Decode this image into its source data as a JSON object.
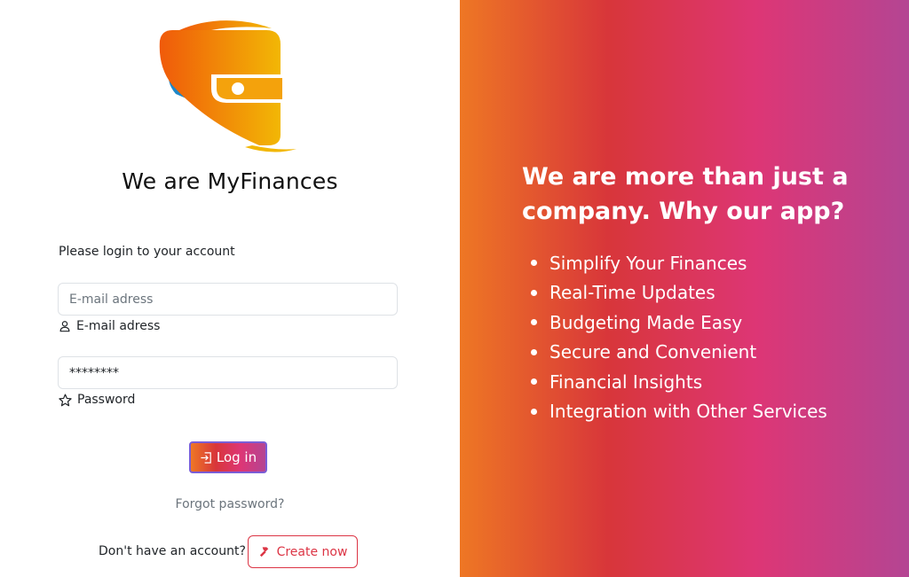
{
  "left": {
    "logo": {
      "icon": "wallet-logo-icon",
      "colors": {
        "orange": "#f05a0a",
        "yellow": "#f2b705",
        "blue": "#1e88c8"
      }
    },
    "title": "We are MyFinances",
    "prompt": "Please login to your account",
    "email": {
      "placeholder": "E-mail adress",
      "label": "E-mail adress",
      "icon": "person-icon"
    },
    "password": {
      "value": "********",
      "label": "Password",
      "icon": "star-icon"
    },
    "login_button": {
      "label": "Log in",
      "icon": "login-icon"
    },
    "forgot_link": "Forgot password?",
    "signup": {
      "prompt": "Don't have an account?",
      "button_label": "Create now",
      "icon": "hammer-icon"
    }
  },
  "right": {
    "headline": "We are more than just a company. Why our app?",
    "features": [
      "Simplify Your Finances",
      "Real-Time Updates",
      "Budgeting Made Easy",
      "Secure and Convenient",
      "Financial Insights",
      "Integration with Other Services"
    ]
  },
  "colors": {
    "gradient": [
      "#ee7724",
      "#d8363a",
      "#dd3675",
      "#b44593"
    ],
    "danger": "#dc3545"
  }
}
